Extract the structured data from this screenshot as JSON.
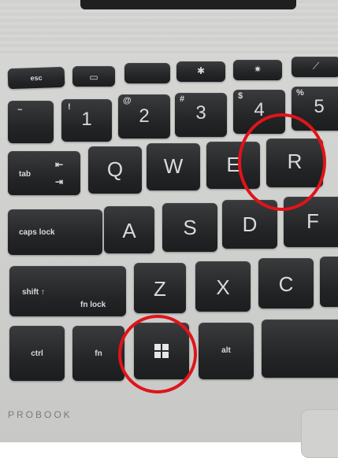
{
  "brand_text": "PROBOOK",
  "keys": {
    "esc": "esc",
    "tab": "tab",
    "caps": "caps lock",
    "shift": "shift ↑",
    "fnlock": "fn lock",
    "ctrl": "ctrl",
    "fn": "fn",
    "alt": "alt",
    "num1": "1",
    "num2": "2",
    "num3": "3",
    "num4": "4",
    "num5": "5",
    "sym1": "!",
    "sym2": "@",
    "sym3": "#",
    "sym4": "$",
    "sym5": "%",
    "tilde": "~",
    "Q": "Q",
    "W": "W",
    "E": "E",
    "R": "R",
    "A": "A",
    "S": "S",
    "D": "D",
    "F": "F",
    "Z": "Z",
    "X": "X",
    "C": "C"
  },
  "annotations": {
    "circle_color": "#e0141a",
    "highlighted_keys": [
      "R",
      "windows"
    ]
  }
}
